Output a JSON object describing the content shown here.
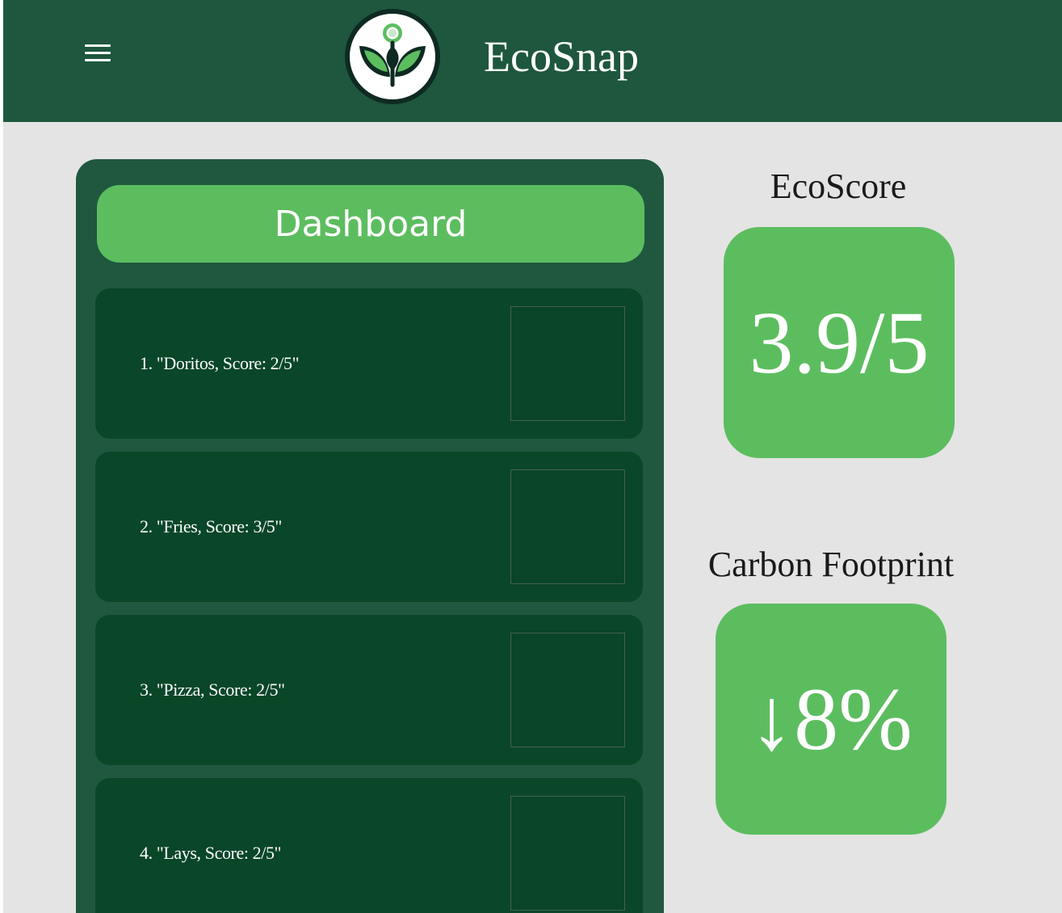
{
  "header": {
    "menu_icon": "hamburger-menu-icon",
    "logo_icon": "leaf-sprout-logo-icon",
    "title": "EcoSnap"
  },
  "dashboard": {
    "title": "Dashboard",
    "items": [
      {
        "label": "1. \"Doritos, Score: 2/5\""
      },
      {
        "label": "2. \"Fries, Score: 3/5\""
      },
      {
        "label": "3. \"Pizza, Score: 2/5\""
      },
      {
        "label": "4. \"Lays, Score: 2/5\""
      }
    ]
  },
  "eco_score": {
    "label": "EcoScore",
    "value": "3.9/5"
  },
  "carbon_footprint": {
    "label": "Carbon Footprint",
    "value": "↓8%"
  },
  "colors": {
    "header_bg": "#1e573d",
    "accent_green": "#5cbd5f",
    "panel_bg": "#1f583e",
    "item_bg": "#0a4628",
    "page_bg": "#e4e4e4"
  }
}
